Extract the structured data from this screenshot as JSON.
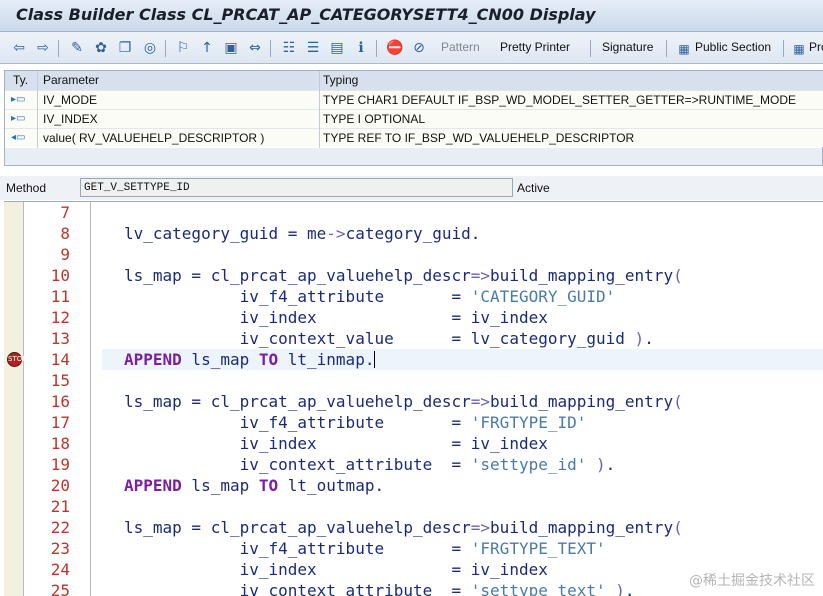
{
  "window": {
    "title": "Class Builder Class CL_PRCAT_AP_CATEGORYSETT4_CN00 Display"
  },
  "toolbar": {
    "pattern_label": "Pattern",
    "pretty_printer_label": "Pretty Printer",
    "signature_label": "Signature",
    "public_section_label": "Public Section",
    "next_label": "Pro"
  },
  "params": {
    "headers": {
      "type": "Ty.",
      "parameter": "Parameter",
      "typing": "Typing"
    },
    "rows": [
      {
        "parameter": "IV_MODE",
        "typing": "TYPE CHAR1  DEFAULT IF_BSP_WD_MODEL_SETTER_GETTER=>RUNTIME_MODE",
        "icon": "importing-icon"
      },
      {
        "parameter": "IV_INDEX",
        "typing": "TYPE I OPTIONAL",
        "icon": "importing-icon"
      },
      {
        "parameter": "value( RV_VALUEHELP_DESCRIPTOR )",
        "typing": "TYPE REF TO IF_BSP_WD_VALUEHELP_DESCRIPTOR",
        "icon": "returning-icon"
      }
    ]
  },
  "method": {
    "label": "Method",
    "name": "GET_V_SETTYPE_ID",
    "status": "Active"
  },
  "editor": {
    "current_line": 14,
    "breakpoint_line": 14,
    "lines": [
      {
        "num": "7",
        "code": ""
      },
      {
        "num": "8",
        "code": "lv_category_guid = me->category_guid."
      },
      {
        "num": "9",
        "code": ""
      },
      {
        "num": "10",
        "code": "ls_map = cl_prcat_ap_valuehelp_descr=>build_mapping_entry("
      },
      {
        "num": "11",
        "code": "            iv_f4_attribute       = 'CATEGORY_GUID'"
      },
      {
        "num": "12",
        "code": "            iv_index              = iv_index"
      },
      {
        "num": "13",
        "code": "            iv_context_value      = lv_category_guid )."
      },
      {
        "num": "14",
        "code": "APPEND ls_map TO lt_inmap."
      },
      {
        "num": "15",
        "code": ""
      },
      {
        "num": "16",
        "code": "ls_map = cl_prcat_ap_valuehelp_descr=>build_mapping_entry("
      },
      {
        "num": "17",
        "code": "            iv_f4_attribute       = 'FRGTYPE_ID'"
      },
      {
        "num": "18",
        "code": "            iv_index              = iv_index"
      },
      {
        "num": "19",
        "code": "            iv_context_attribute  = 'settype_id' )."
      },
      {
        "num": "20",
        "code": "APPEND ls_map TO lt_outmap."
      },
      {
        "num": "21",
        "code": ""
      },
      {
        "num": "22",
        "code": "ls_map = cl_prcat_ap_valuehelp_descr=>build_mapping_entry("
      },
      {
        "num": "23",
        "code": "            iv_f4_attribute       = 'FRGTYPE_TEXT'"
      },
      {
        "num": "24",
        "code": "            iv_index              = iv_index"
      },
      {
        "num": "25",
        "code": "            iv_context_attribute  = 'settype_text' )."
      }
    ]
  },
  "watermark": "@稀土掘金技术社区"
}
